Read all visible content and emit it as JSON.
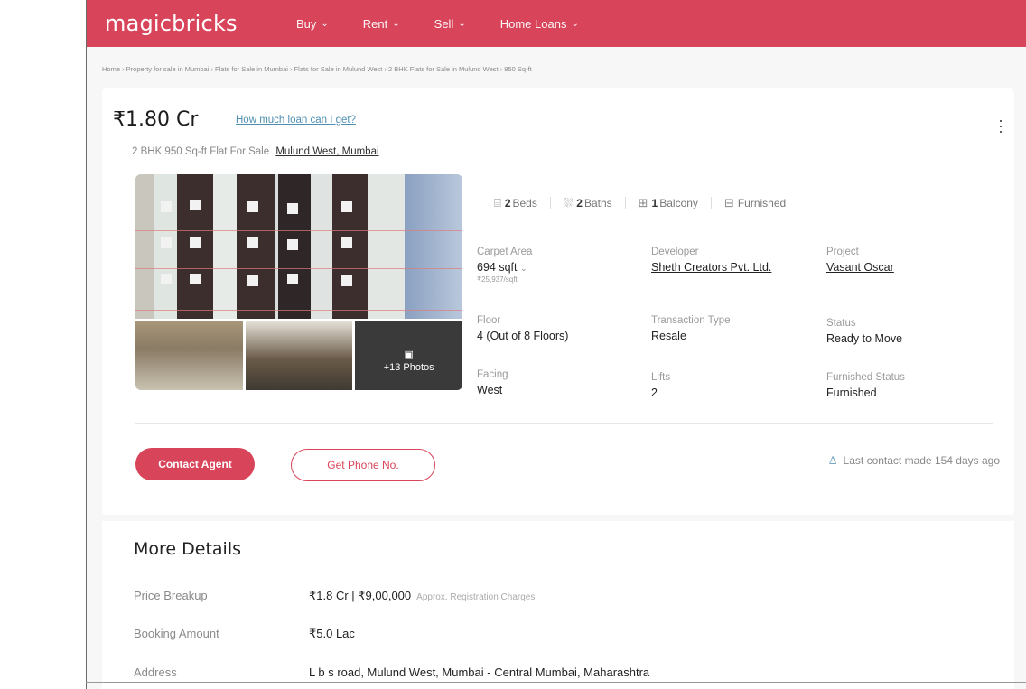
{
  "header": {
    "logo": "magicbricks",
    "nav": [
      {
        "label": "Buy"
      },
      {
        "label": "Rent"
      },
      {
        "label": "Sell"
      },
      {
        "label": "Home Loans"
      }
    ]
  },
  "breadcrumb": "Home › Property for sale in Mumbai › Flats for Sale in Mumbai › Flats for Sale in Mulund West › 2 BHK Flats for Sale in Mulund West › 950 Sq-ft",
  "listing": {
    "price": "₹1.80 Cr",
    "loan_link": "How much loan can I get?",
    "subtitle": "2 BHK 950 Sq-ft Flat For Sale",
    "location": "Mulund West, Mumbai",
    "more_photos": "+13 Photos",
    "amenities": {
      "beds_num": "2",
      "beds_label": "Beds",
      "baths_num": "2",
      "baths_label": "Baths",
      "balcony_num": "1",
      "balcony_label": "Balcony",
      "furnished_label": "Furnished"
    },
    "facts": {
      "carpet_area": {
        "label": "Carpet Area",
        "value": "694 sqft",
        "sub": "₹25,937/sqft"
      },
      "developer": {
        "label": "Developer",
        "value": "Sheth Creators Pvt. Ltd."
      },
      "project": {
        "label": "Project",
        "value": "Vasant Oscar"
      },
      "floor": {
        "label": "Floor",
        "value": "4 (Out of 8 Floors)"
      },
      "transaction": {
        "label": "Transaction Type",
        "value": "Resale"
      },
      "status": {
        "label": "Status",
        "value": "Ready to Move"
      },
      "facing": {
        "label": "Facing",
        "value": "West"
      },
      "lifts": {
        "label": "Lifts",
        "value": "2"
      },
      "furnished_status": {
        "label": "Furnished Status",
        "value": "Furnished"
      }
    },
    "contact_button": "Contact Agent",
    "phone_button": "Get Phone No.",
    "last_contact": "Last contact made 154 days ago"
  },
  "more_details": {
    "title": "More Details",
    "rows": [
      {
        "label": "Price Breakup",
        "value": "₹1.8 Cr | ₹9,00,000",
        "note": "Approx. Registration Charges"
      },
      {
        "label": "Booking Amount",
        "value": "₹5.0 Lac"
      },
      {
        "label": "Address",
        "value": "L b s road, Mulund West, Mumbai - Central Mumbai, Maharashtra"
      }
    ]
  },
  "colors": {
    "brand": "#d8455a",
    "link": "#4e8fb1"
  }
}
